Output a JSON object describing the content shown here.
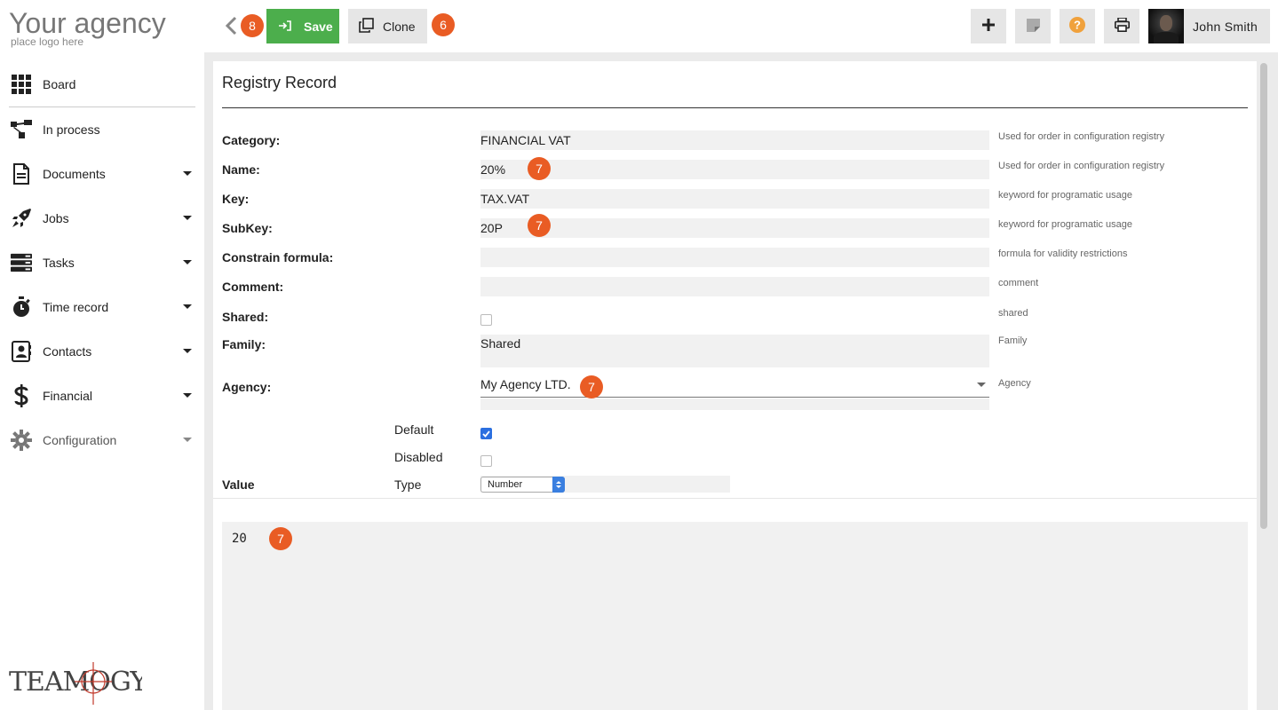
{
  "brand": {
    "logo_main": "Your agency",
    "logo_sub": "place logo here",
    "footer_logo": "TEAMOGY"
  },
  "sidebar": {
    "items": [
      {
        "label": "Board",
        "icon": "grid-icon"
      },
      {
        "label": "In process",
        "icon": "flow-icon"
      },
      {
        "label": "Documents",
        "icon": "document-icon"
      },
      {
        "label": "Jobs",
        "icon": "rocket-icon"
      },
      {
        "label": "Tasks",
        "icon": "tasks-icon"
      },
      {
        "label": "Time record",
        "icon": "stopwatch-icon"
      },
      {
        "label": "Contacts",
        "icon": "contacts-icon"
      },
      {
        "label": "Financial",
        "icon": "dollar-icon"
      },
      {
        "label": "Configuration",
        "icon": "gear-icon"
      }
    ]
  },
  "toolbar": {
    "back_badge": "8",
    "save_label": "Save",
    "clone_label": "Clone",
    "clone_badge": "6",
    "user_name": "John Smith"
  },
  "form": {
    "title": "Registry Record",
    "badge": "7",
    "fields": {
      "category": {
        "label": "Category:",
        "value": "FINANCIAL VAT",
        "hint": "Used for order in configuration registry"
      },
      "name": {
        "label": "Name:",
        "value": "20%",
        "hint": "Used for order in configuration registry"
      },
      "key": {
        "label": "Key:",
        "value": "TAX.VAT",
        "hint": "keyword for programatic usage"
      },
      "subkey": {
        "label": "SubKey:",
        "value": "20P",
        "hint": "keyword for programatic usage"
      },
      "constrain": {
        "label": "Constrain formula:",
        "value": "",
        "hint": "formula for validity restrictions"
      },
      "comment": {
        "label": "Comment:",
        "value": "",
        "hint": "comment"
      },
      "shared": {
        "label": "Shared:",
        "checked": false,
        "hint": "shared"
      },
      "family": {
        "label": "Family:",
        "value": "Shared",
        "hint": "Family"
      },
      "agency": {
        "label": "Agency:",
        "value": "My Agency LTD.",
        "hint": "Agency"
      }
    },
    "default_label": "Default",
    "default_checked": true,
    "disabled_label": "Disabled",
    "disabled_checked": false,
    "value_label": "Value",
    "type_label": "Type",
    "type_value": "Number",
    "value_content": "20"
  },
  "colors": {
    "accent_badge": "#e95c24",
    "save_green": "#4cae4c",
    "help_orange": "#f0a13c",
    "checkbox_blue": "#2b6fe0"
  }
}
